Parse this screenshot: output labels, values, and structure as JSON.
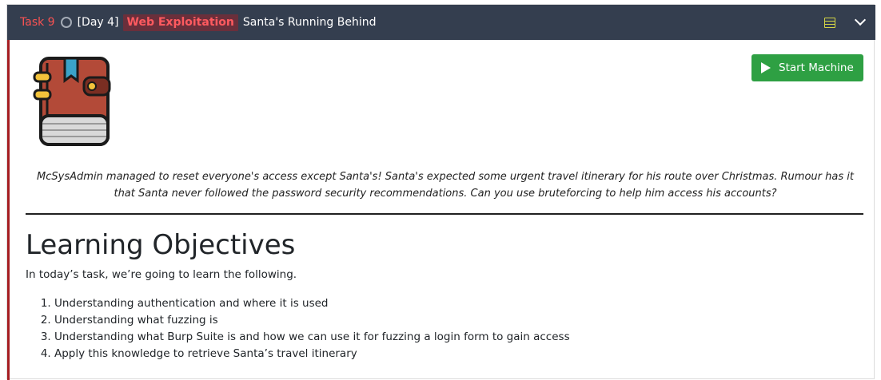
{
  "task": {
    "number_label": "Task 9",
    "day_label": "[Day 4]",
    "category_label": "Web Exploitation",
    "title": "Santa's Running Behind"
  },
  "header_icons": {
    "menu": "list-icon",
    "toggle": "chevron-down-icon"
  },
  "start_button": {
    "label": "Start Machine",
    "icon": "play-icon"
  },
  "intro": "McSysAdmin managed to reset everyone's access except Santa's! Santa's expected some urgent travel itinerary for his route over Christmas. Rumour has it that Santa never followed the password security recommendations. Can you use bruteforcing to help him access his accounts?",
  "section": {
    "heading": "Learning Objectives",
    "lead": "In today’s task, we’re going to learn the following.",
    "objectives": [
      "Understanding authentication and where it is used",
      "Understanding what fuzzing is",
      "Understanding what Burp Suite is and how we can use it for fuzzing a login form to gain access",
      "Apply this knowledge to retrieve Santa’s travel itinerary"
    ]
  },
  "colors": {
    "header_bg": "#343e4f",
    "task_number": "#fa5252",
    "category_bg": "#6a2f3b",
    "category_text": "#ff5a5f",
    "accent_bar": "#a51d22",
    "start_button": "#2ea043"
  }
}
